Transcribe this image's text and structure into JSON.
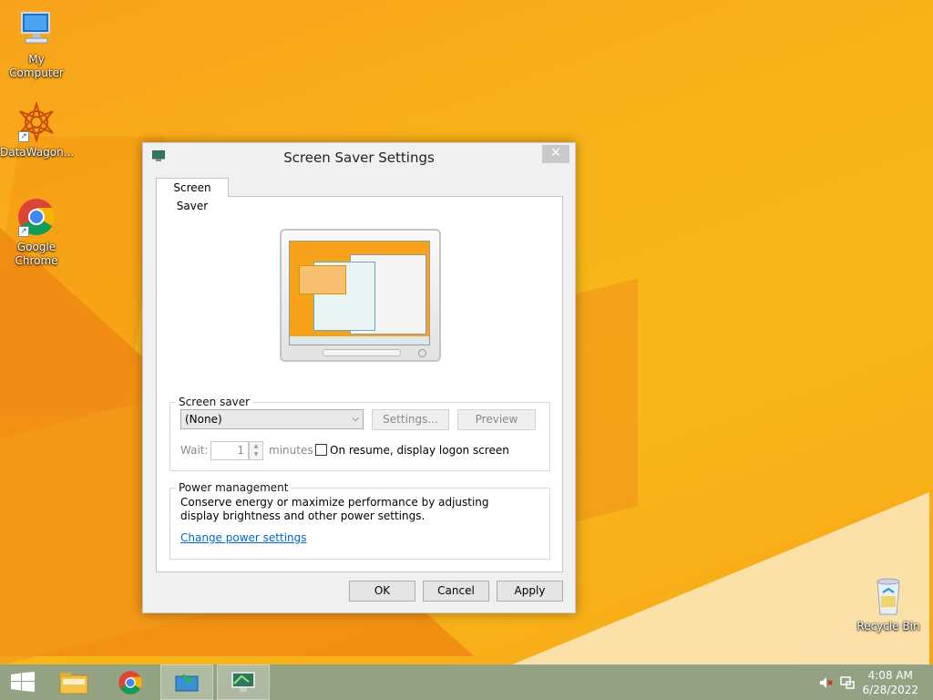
{
  "desktop": {
    "icons": [
      {
        "label": "My Computer"
      },
      {
        "label": "DataWagon..."
      },
      {
        "label": "Google Chrome"
      },
      {
        "label": "Recycle Bin"
      }
    ]
  },
  "dialog": {
    "title": "Screen Saver Settings",
    "close_glyph": "✕",
    "tab_label": "Screen Saver",
    "screen_saver": {
      "legend": "Screen saver",
      "selected": "(None)",
      "settings_label": "Settings...",
      "preview_label": "Preview",
      "wait_label": "Wait:",
      "wait_value": "1",
      "minutes_label": "minutes",
      "resume_label": "On resume, display logon screen",
      "resume_checked": false
    },
    "power": {
      "legend": "Power management",
      "description": "Conserve energy or maximize performance by adjusting display brightness and other power settings.",
      "link": "Change power settings"
    },
    "buttons": {
      "ok": "OK",
      "cancel": "Cancel",
      "apply": "Apply"
    }
  },
  "taskbar": {
    "time": "4:08 AM",
    "date": "6/28/2022",
    "items": [
      "start-button",
      "file-explorer-icon",
      "chrome-icon",
      "switcher-icon",
      "screen-saver-icon"
    ]
  }
}
